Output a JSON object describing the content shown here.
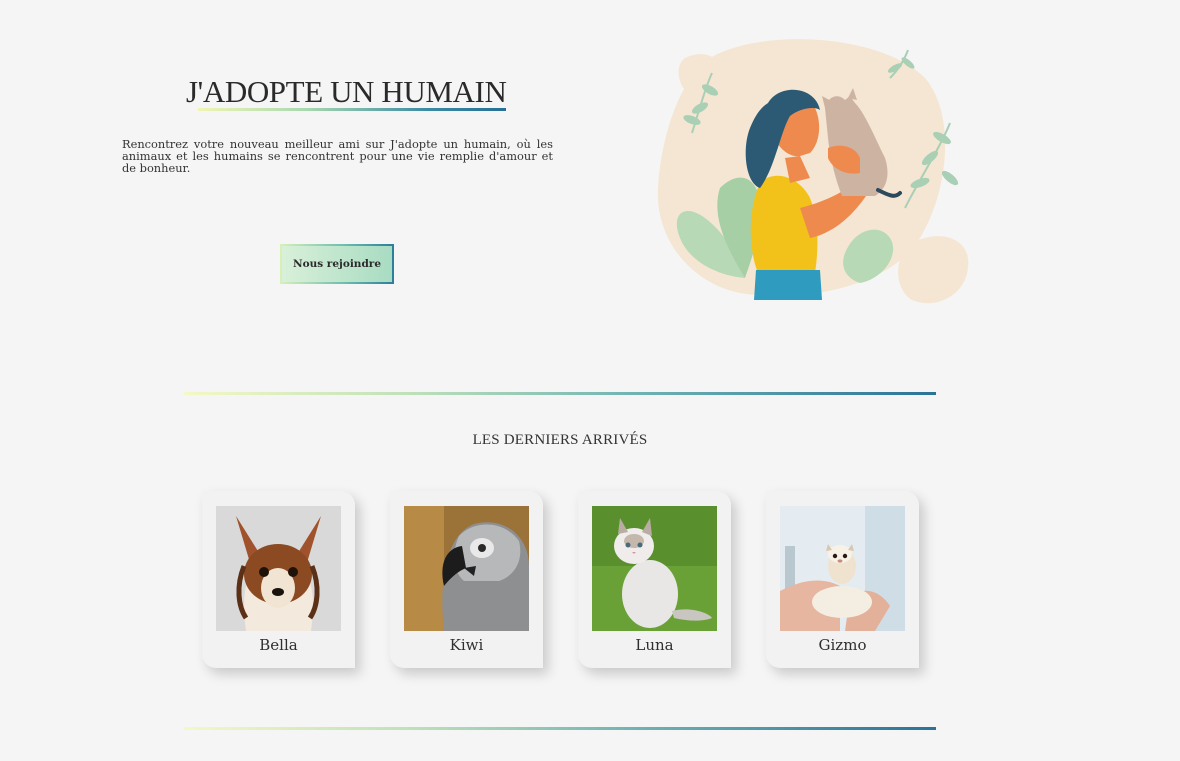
{
  "hero": {
    "title": "J'ADOPTE UN HUMAIN",
    "description": "Rencontrez votre nouveau meilleur ami sur J'adopte un humain, où les animaux et les humains se rencontrent pour une vie remplie d'amour et de bonheur.",
    "join_button": "Nous rejoindre",
    "illustration_icon": "woman-holding-cat-illustration"
  },
  "latest": {
    "title": "LES DERNIERS ARRIVÉS",
    "pets": [
      {
        "name": "Bella",
        "photo": "chihuahua-photo"
      },
      {
        "name": "Kiwi",
        "photo": "grey-parrot-photo"
      },
      {
        "name": "Luna",
        "photo": "white-cat-photo"
      },
      {
        "name": "Gizmo",
        "photo": "ferret-photo"
      }
    ]
  },
  "colors": {
    "gradient_start": "#f0f5b5",
    "gradient_mid": "#a9d8b0",
    "gradient_end": "#276f95",
    "background": "#f5f5f5"
  }
}
